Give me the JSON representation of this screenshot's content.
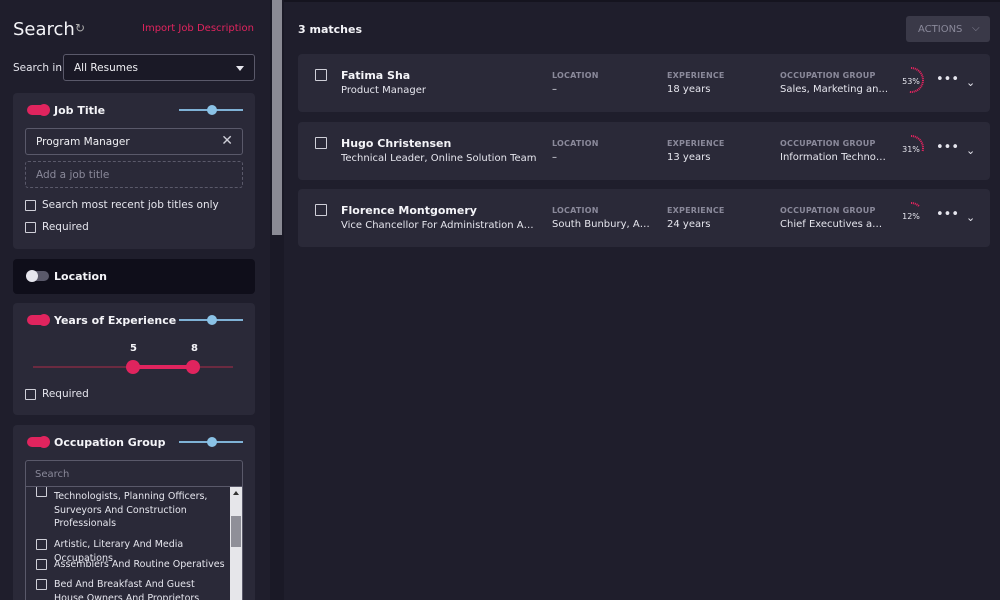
{
  "sidebar": {
    "title": "Search",
    "import_link": "Import Job Description",
    "search_in_label": "Search in",
    "search_in_value": "All Resumes",
    "job_title": {
      "label": "Job Title",
      "enabled": true,
      "chip": "Program Manager",
      "add_placeholder": "Add a job title",
      "recent_only_label": "Search most recent job titles only",
      "required_label": "Required"
    },
    "location": {
      "label": "Location",
      "enabled": false
    },
    "experience": {
      "label": "Years of Experience",
      "enabled": true,
      "min": "5",
      "max": "8",
      "required_label": "Required"
    },
    "occupation": {
      "label": "Occupation Group",
      "enabled": true,
      "search_placeholder": "Search",
      "items": [
        "Technologists, Planning Officers, Surveyors And Construction Professionals",
        "Artistic, Literary And Media Occupations",
        "Assemblers And Routine Operatives",
        "Bed And Breakfast And Guest House Owners And Proprietors"
      ]
    }
  },
  "main": {
    "matches": "3 matches",
    "actions_label": "ACTIONS",
    "labels": {
      "location": "LOCATION",
      "experience": "EXPERIENCE",
      "occupation": "OCCUPATION GROUP"
    },
    "results": [
      {
        "name": "Fatima Sha",
        "title": "Product Manager",
        "location": "–",
        "experience": "18 years",
        "occupation": "Sales, Marketing an...",
        "score": 53,
        "score_label": "53%"
      },
      {
        "name": "Hugo Christensen",
        "title": "Technical Leader, Online Solution Team",
        "location": "–",
        "experience": "13 years",
        "occupation": "Information Technol...",
        "score": 31,
        "score_label": "31%"
      },
      {
        "name": "Florence Montgomery",
        "title": "Vice Chancellor For Administration And Fi...",
        "location": "South Bunbury, Aust...",
        "experience": "24 years",
        "occupation": "Chief Executives and...",
        "score": 12,
        "score_label": "12%"
      }
    ]
  },
  "colors": {
    "accent": "#e0245e",
    "weight": "#8ac2e6",
    "panel": "#2a2938",
    "background": "#1f1e2c"
  }
}
